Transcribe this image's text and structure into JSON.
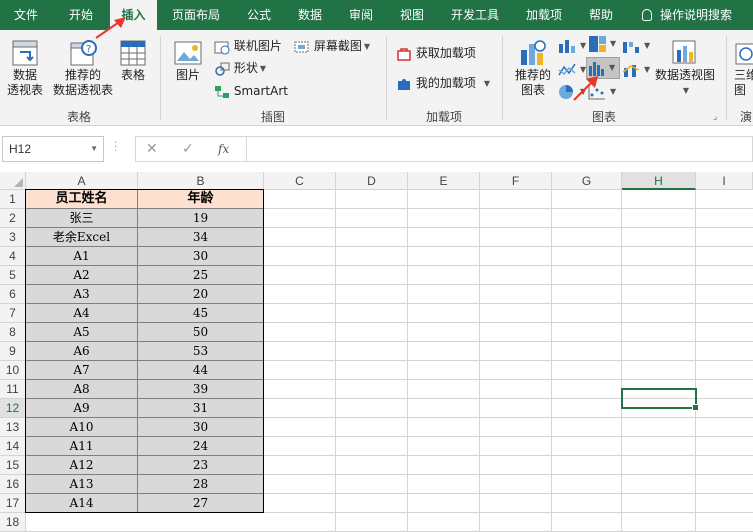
{
  "tabs": [
    "文件",
    "开始",
    "插入",
    "页面布局",
    "公式",
    "数据",
    "审阅",
    "视图",
    "开发工具",
    "加载项",
    "帮助"
  ],
  "active_tab": "插入",
  "tell_me": "操作说明搜索",
  "ribbon": {
    "tables": {
      "label": "表格",
      "pivot_label_1": "数据",
      "pivot_label_2": "透视表",
      "recommended_pivot_1": "推荐的",
      "recommended_pivot_2": "数据透视表",
      "table": "表格"
    },
    "illustrations": {
      "label": "插图",
      "pictures": "图片",
      "online_pictures": "联机图片",
      "shapes": "形状",
      "smartart": "SmartArt",
      "screenshot": "屏幕截图"
    },
    "addins": {
      "label": "加载项",
      "get_addins": "获取加载项",
      "my_addins": "我的加载项"
    },
    "charts": {
      "label": "图表",
      "recommended_1": "推荐的",
      "recommended_2": "图表",
      "pivot_chart": "数据透视图"
    },
    "partial": {
      "label_1": "三维",
      "label_2": "图",
      "label_3": "演"
    }
  },
  "formula_bar": {
    "name_box": "H12",
    "cancel": "✕",
    "enter": "✓",
    "fx": "fx",
    "formula": ""
  },
  "columns": [
    "A",
    "B",
    "C",
    "D",
    "E",
    "F",
    "G",
    "H",
    "I"
  ],
  "selected_column": "H",
  "rows": [
    "1",
    "2",
    "3",
    "4",
    "5",
    "6",
    "7",
    "8",
    "9",
    "10",
    "11",
    "12",
    "13",
    "14",
    "15",
    "16",
    "17",
    "18"
  ],
  "selected_row": "12",
  "table": {
    "headers": [
      "员工姓名",
      "年龄"
    ],
    "rows": [
      [
        "张三",
        "19"
      ],
      [
        "老余Excel",
        "34"
      ],
      [
        "A1",
        "30"
      ],
      [
        "A2",
        "25"
      ],
      [
        "A3",
        "20"
      ],
      [
        "A4",
        "45"
      ],
      [
        "A5",
        "50"
      ],
      [
        "A6",
        "53"
      ],
      [
        "A7",
        "44"
      ],
      [
        "A8",
        "39"
      ],
      [
        "A9",
        "31"
      ],
      [
        "A10",
        "30"
      ],
      [
        "A11",
        "24"
      ],
      [
        "A12",
        "23"
      ],
      [
        "A13",
        "28"
      ],
      [
        "A14",
        "27"
      ]
    ]
  },
  "colors": {
    "excel_green": "#217346",
    "header_fill": "#fde0cf",
    "data_fill": "#d9d9d9",
    "arrow_red": "#e8372b"
  }
}
